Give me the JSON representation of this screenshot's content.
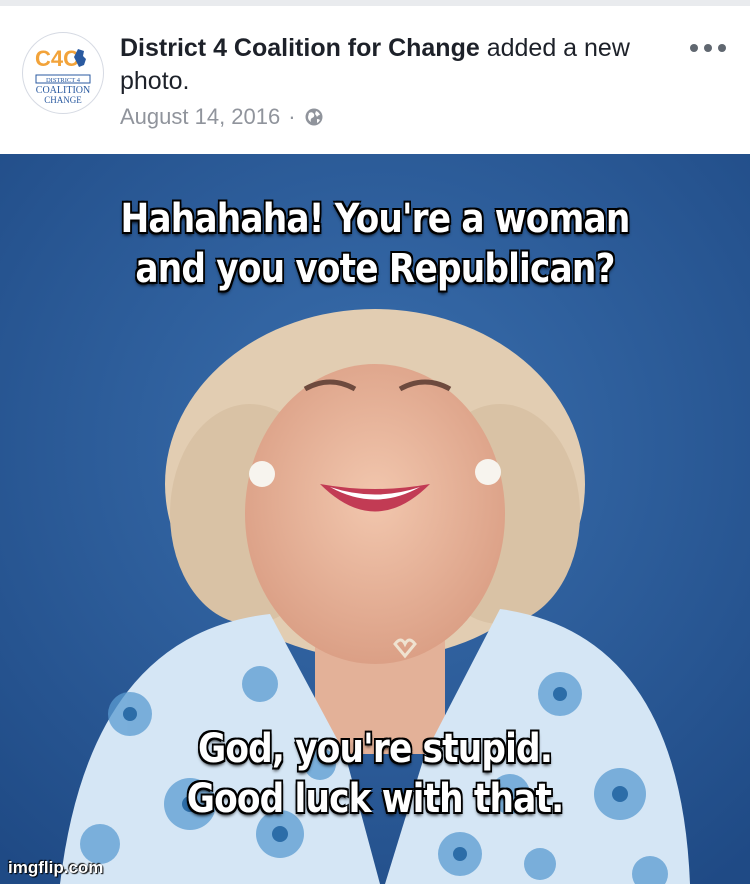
{
  "post": {
    "author": "District 4 Coalition for Change",
    "action": " added a new photo.",
    "date": "August 14, 2016",
    "separator": "·",
    "privacy_icon": "globe-icon",
    "more_icon": "ellipsis-icon"
  },
  "avatar_logo": {
    "monogram": "C4C",
    "line1": "DISTRICT 4",
    "line2": "COALITION",
    "line3": "CHANGE"
  },
  "meme": {
    "top_line1": "Hahahaha! You're a woman",
    "top_line2": "and you vote Republican?",
    "bottom_line1": "God, you're stupid.",
    "bottom_line2": "Good luck with that.",
    "watermark": "imgflip.com"
  },
  "colors": {
    "background_blue": "#2b5a97",
    "author_text": "#1d2129",
    "meta_text": "#90949c",
    "logo_orange": "#f2a33a",
    "logo_blue": "#2a5aa0"
  }
}
